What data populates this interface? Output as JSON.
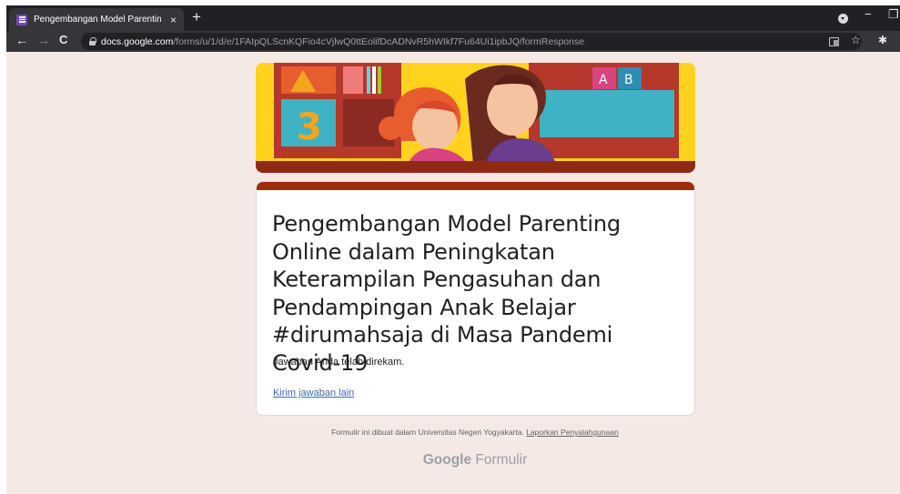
{
  "browser": {
    "tab": {
      "title": "Pengembangan Model Parenting",
      "close": "×"
    },
    "new_tab": "+",
    "window": {
      "minimize": "−",
      "restore": "❐"
    },
    "nav": {
      "back": "←",
      "forward": "→",
      "reload": "C"
    },
    "address": {
      "host": "docs.google.com",
      "path": "/forms/u/1/d/e/1FAIpQLScnKQFio4cVjlwQ0ttEolifDcADNvR5hWIkf7Fu64Ui1ipbJQ/formResponse"
    },
    "toolbar_icons": {
      "star": "☆",
      "extensions": "✱"
    }
  },
  "form": {
    "header_image": {
      "block_letter_a": "A",
      "block_letter_b": "B",
      "number": "3",
      "colors": {
        "background": "#ffd21e",
        "shelf": "#b5382a",
        "teal": "#3fb3c4",
        "dress": "#d94380"
      }
    },
    "accent_color": "#9e2d0e",
    "title": "Pengembangan Model Parenting Online dalam Peningkatan Keterampilan Pengasuhan dan Pendampingan Anak Belajar #dirumahsaja di Masa Pandemi Covid-19",
    "confirmation": "Jawaban Anda telah direkam.",
    "resubmit_link": "Kirim jawaban lain"
  },
  "footer": {
    "note": "Formulir ini dibuat dalam Universitas Negeri Yogyakarta.",
    "report_link": "Laporkan Penyalahgunaan",
    "brand_google": "Google",
    "brand_product": "Formulir"
  }
}
